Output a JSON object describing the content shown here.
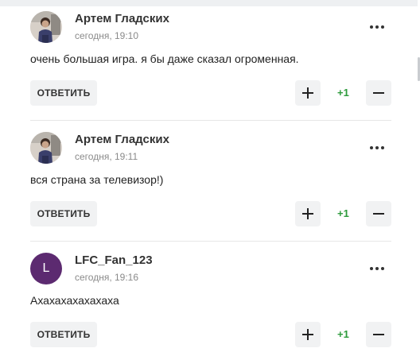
{
  "colors": {
    "score_positive": "#2e9b3c",
    "button_bg": "#f1f2f3",
    "avatar_letter_bg": "#5c2a70"
  },
  "comments": [
    {
      "author": "Артем Гладских",
      "time": "сегодня, 19:10",
      "text": "очень большая игра. я бы даже сказал огроменная.",
      "avatar": "photo-avatar",
      "reply_label": "ОТВЕТИТЬ",
      "score": "+1",
      "more_icon": "more-icon",
      "plus_icon": "plus-icon",
      "minus_icon": "minus-icon"
    },
    {
      "author": "Артем Гладских",
      "time": "сегодня, 19:11",
      "text": "вся страна за телевизор!)",
      "avatar": "photo-avatar",
      "reply_label": "ОТВЕТИТЬ",
      "score": "+1",
      "more_icon": "more-icon",
      "plus_icon": "plus-icon",
      "minus_icon": "minus-icon"
    },
    {
      "author": "LFC_Fan_123",
      "time": "сегодня, 19:16",
      "text": "Ахахахахахахаха",
      "avatar": "letter-avatar",
      "avatar_letter": "L",
      "reply_label": "ОТВЕТИТЬ",
      "score": "+1",
      "more_icon": "more-icon",
      "plus_icon": "plus-icon",
      "minus_icon": "minus-icon"
    }
  ]
}
